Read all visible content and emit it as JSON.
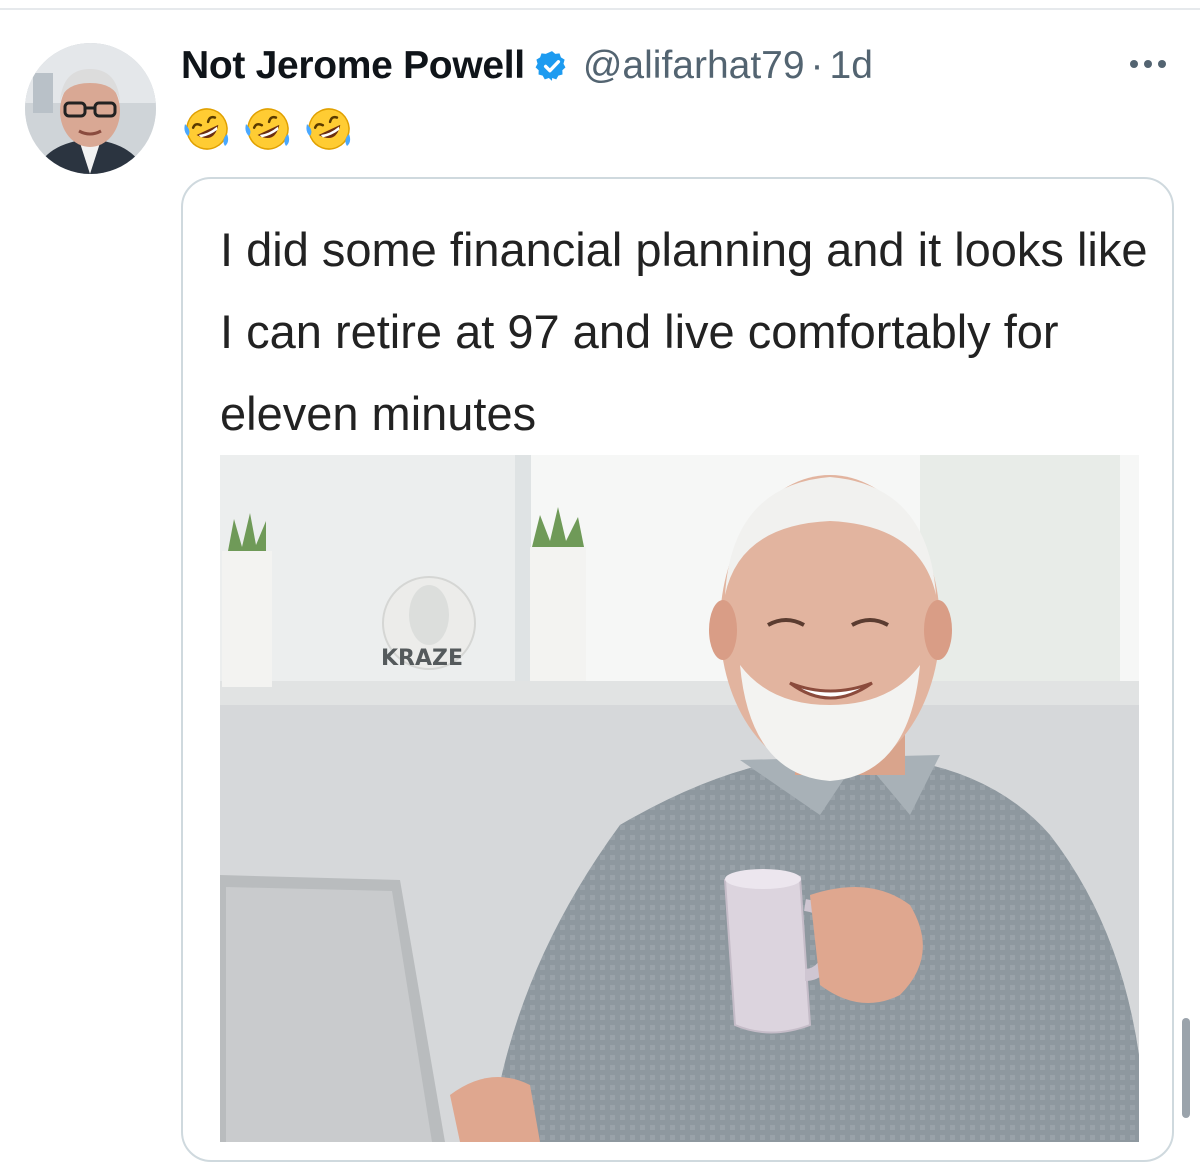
{
  "post": {
    "author": {
      "display_name": "Not Jerome Powell",
      "handle": "@alifarhat79",
      "verified": true,
      "avatar_icon": "profile-photo"
    },
    "separator": "·",
    "time": "1d",
    "text_emojis": [
      "🤣",
      "🤣",
      "🤣"
    ],
    "more_icon": "ellipsis-icon",
    "media": {
      "caption": "I did some financial planning and it looks like I can retire at 97 and live comfortably for eleven minutes",
      "watermark": "KRAZE"
    }
  },
  "colors": {
    "text_primary": "#0f1419",
    "text_secondary": "#536471",
    "verified_blue": "#1d9bf0",
    "border": "#cfd9de"
  }
}
